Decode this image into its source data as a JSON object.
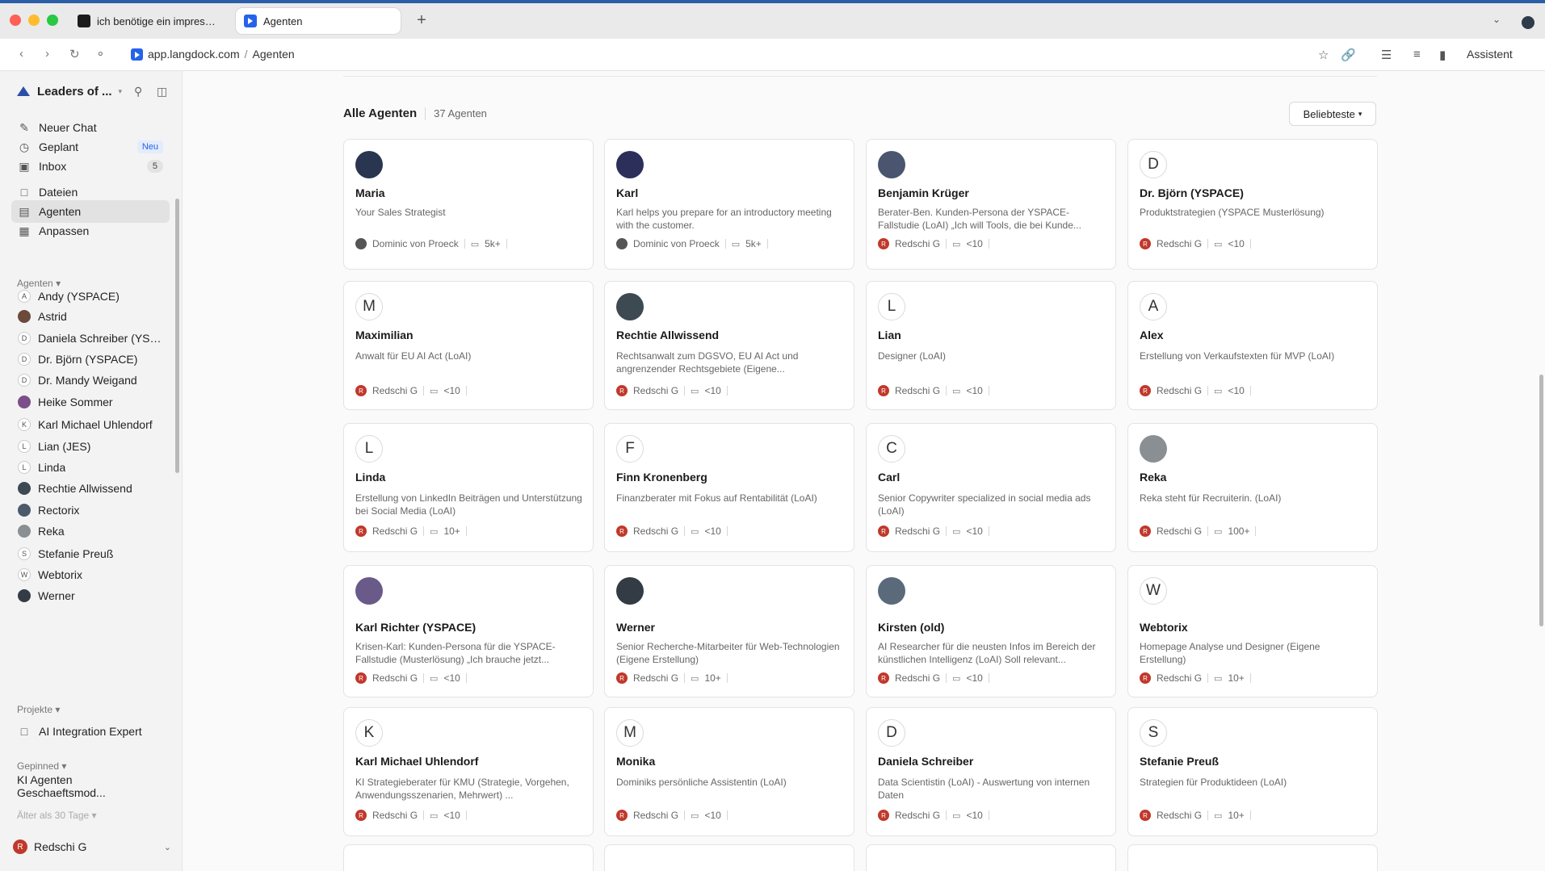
{
  "browser": {
    "tabs": [
      {
        "label": "ich benötige ein impressum f"
      },
      {
        "label": "Agenten"
      }
    ],
    "new_tab": "+",
    "url_host": "app.langdock.com",
    "url_sep": "/",
    "url_page": "Agenten",
    "assistant_label": "Assistent"
  },
  "sidebar": {
    "workspace": "Leaders of ...",
    "nav": [
      {
        "label": "Neuer Chat",
        "icon": "edit-icon"
      },
      {
        "label": "Geplant",
        "icon": "clock-icon",
        "badge": "Neu"
      },
      {
        "label": "Inbox",
        "icon": "inbox-icon",
        "count": "5"
      },
      {
        "label": "Dateien",
        "icon": "folder-icon"
      },
      {
        "label": "Agenten",
        "icon": "agents-icon",
        "active": true
      },
      {
        "label": "Anpassen",
        "icon": "grid-icon"
      }
    ],
    "agents_title": "Agenten",
    "agents": [
      {
        "name": "Andy (YSPACE)",
        "initial": "A"
      },
      {
        "name": "Astrid",
        "initial": "",
        "photo": "#6b4a3a"
      },
      {
        "name": "Daniela Schreiber (YSP...",
        "initial": "D"
      },
      {
        "name": "Dr. Björn (YSPACE)",
        "initial": "D"
      },
      {
        "name": "Dr. Mandy Weigand",
        "initial": "D"
      },
      {
        "name": "Heike Sommer",
        "initial": "",
        "photo": "#7a4f8a"
      },
      {
        "name": "Karl Michael Uhlendorf",
        "initial": "K"
      },
      {
        "name": "Lian (JES)",
        "initial": "L"
      },
      {
        "name": "Linda",
        "initial": "L"
      },
      {
        "name": "Rechtie Allwissend",
        "initial": "",
        "photo": "#3d4a52"
      },
      {
        "name": "Rectorix",
        "initial": "",
        "photo": "#4a5a6a"
      },
      {
        "name": "Reka",
        "initial": "",
        "photo": "#8a8f94"
      },
      {
        "name": "Stefanie Preuß",
        "initial": "S"
      },
      {
        "name": "Webtorix",
        "initial": "W"
      },
      {
        "name": "Werner",
        "initial": "",
        "photo": "#333c44"
      }
    ],
    "projects_title": "Projekte",
    "projects": [
      {
        "name": "AI Integration Expert"
      }
    ],
    "pinned_title": "Gepinned",
    "pinned": [
      {
        "name": "KI Agenten Geschaeftsmod..."
      }
    ],
    "older_title": "Älter als 30 Tage",
    "user": {
      "name": "Redschi G",
      "initial": "R"
    }
  },
  "main": {
    "title": "Alle Agenten",
    "count": "37 Agenten",
    "sort_label": "Beliebteste"
  },
  "cards": [
    {
      "name": "Maria",
      "desc": "Your Sales Strategist",
      "owner": "Dominic von Proeck",
      "owner_initial": "",
      "uses": "5k+",
      "avatar": "",
      "photo": "#2a3550"
    },
    {
      "name": "Karl",
      "desc": "Karl helps you prepare for an introductory meeting with the customer.",
      "owner": "Dominic von Proeck",
      "owner_initial": "",
      "uses": "5k+",
      "avatar": "",
      "photo": "#2b2f5a"
    },
    {
      "name": "Benjamin Krüger",
      "desc": "Berater-Ben. Kunden-Persona der YSPACE-Fallstudie (LoAI) „Ich will Tools, die bei Kunde...",
      "owner": "Redschi G",
      "owner_initial": "R",
      "uses": "<10",
      "avatar": "",
      "photo": "#4a5570"
    },
    {
      "name": "Dr. Björn (YSPACE)",
      "desc": "Produktstrategien (YSPACE Musterlösung)",
      "owner": "Redschi G",
      "owner_initial": "R",
      "uses": "<10",
      "avatar": "D",
      "photo": ""
    },
    {
      "name": "Maximilian",
      "desc": "Anwalt für EU AI Act (LoAI)",
      "owner": "Redschi G",
      "owner_initial": "R",
      "uses": "<10",
      "avatar": "M",
      "photo": ""
    },
    {
      "name": "Rechtie Allwissend",
      "desc": "Rechtsanwalt zum DGSVO, EU AI Act und angrenzender Rechtsgebiete (Eigene...",
      "owner": "Redschi G",
      "owner_initial": "R",
      "uses": "<10",
      "avatar": "",
      "photo": "#3d4a52"
    },
    {
      "name": "Lian",
      "desc": "Designer (LoAI)",
      "owner": "Redschi G",
      "owner_initial": "R",
      "uses": "<10",
      "avatar": "L",
      "photo": ""
    },
    {
      "name": "Alex",
      "desc": "Erstellung von Verkaufstexten für MVP (LoAI)",
      "owner": "Redschi G",
      "owner_initial": "R",
      "uses": "<10",
      "avatar": "A",
      "photo": ""
    },
    {
      "name": "Linda",
      "desc": "Erstellung von LinkedIn Beiträgen und Unterstützung bei Social Media (LoAI)",
      "owner": "Redschi G",
      "owner_initial": "R",
      "uses": "10+",
      "avatar": "L",
      "photo": ""
    },
    {
      "name": "Finn Kronenberg",
      "desc": "Finanzberater mit Fokus auf Rentabilität (LoAI)",
      "owner": "Redschi G",
      "owner_initial": "R",
      "uses": "<10",
      "avatar": "F",
      "photo": ""
    },
    {
      "name": "Carl",
      "desc": "Senior Copywriter specialized in social media ads (LoAI)",
      "owner": "Redschi G",
      "owner_initial": "R",
      "uses": "<10",
      "avatar": "C",
      "photo": ""
    },
    {
      "name": "Reka",
      "desc": "Reka steht für Recruiterin. (LoAI)",
      "owner": "Redschi G",
      "owner_initial": "R",
      "uses": "100+",
      "avatar": "",
      "photo": "#8a8f94"
    },
    {
      "name": "Karl Richter (YSPACE)",
      "desc": "Krisen-Karl: Kunden-Persona für die YSPACE-Fallstudie (Musterlösung) „Ich brauche jetzt...",
      "owner": "Redschi G",
      "owner_initial": "R",
      "uses": "<10",
      "avatar": "",
      "photo": "#6a5a8a"
    },
    {
      "name": "Werner",
      "desc": "Senior Recherche-Mitarbeiter für Web-Technologien (Eigene Erstellung)",
      "owner": "Redschi G",
      "owner_initial": "R",
      "uses": "10+",
      "avatar": "",
      "photo": "#333c44"
    },
    {
      "name": "Kirsten (old)",
      "desc": "AI Researcher für die neusten Infos im Bereich der künstlichen Intelligenz (LoAI) Soll relevant...",
      "owner": "Redschi G",
      "owner_initial": "R",
      "uses": "<10",
      "avatar": "",
      "photo": "#5a6a7a"
    },
    {
      "name": "Webtorix",
      "desc": "Homepage Analyse und Designer (Eigene Erstellung)",
      "owner": "Redschi G",
      "owner_initial": "R",
      "uses": "10+",
      "avatar": "W",
      "photo": ""
    },
    {
      "name": "Karl Michael Uhlendorf",
      "desc": "KI Strategieberater für KMU (Strategie, Vorgehen, Anwendungsszenarien, Mehrwert) ...",
      "owner": "Redschi G",
      "owner_initial": "R",
      "uses": "<10",
      "avatar": "K",
      "photo": ""
    },
    {
      "name": "Monika",
      "desc": "Dominiks persönliche Assistentin (LoAI)",
      "owner": "Redschi G",
      "owner_initial": "R",
      "uses": "<10",
      "avatar": "M",
      "photo": ""
    },
    {
      "name": "Daniela Schreiber",
      "desc": "Data Scientistin (LoAI) - Auswertung von internen Daten",
      "owner": "Redschi G",
      "owner_initial": "R",
      "uses": "<10",
      "avatar": "D",
      "photo": ""
    },
    {
      "name": "Stefanie Preuß",
      "desc": "Strategien für Produktideen (LoAI)",
      "owner": "Redschi G",
      "owner_initial": "R",
      "uses": "10+",
      "avatar": "S",
      "photo": ""
    }
  ]
}
